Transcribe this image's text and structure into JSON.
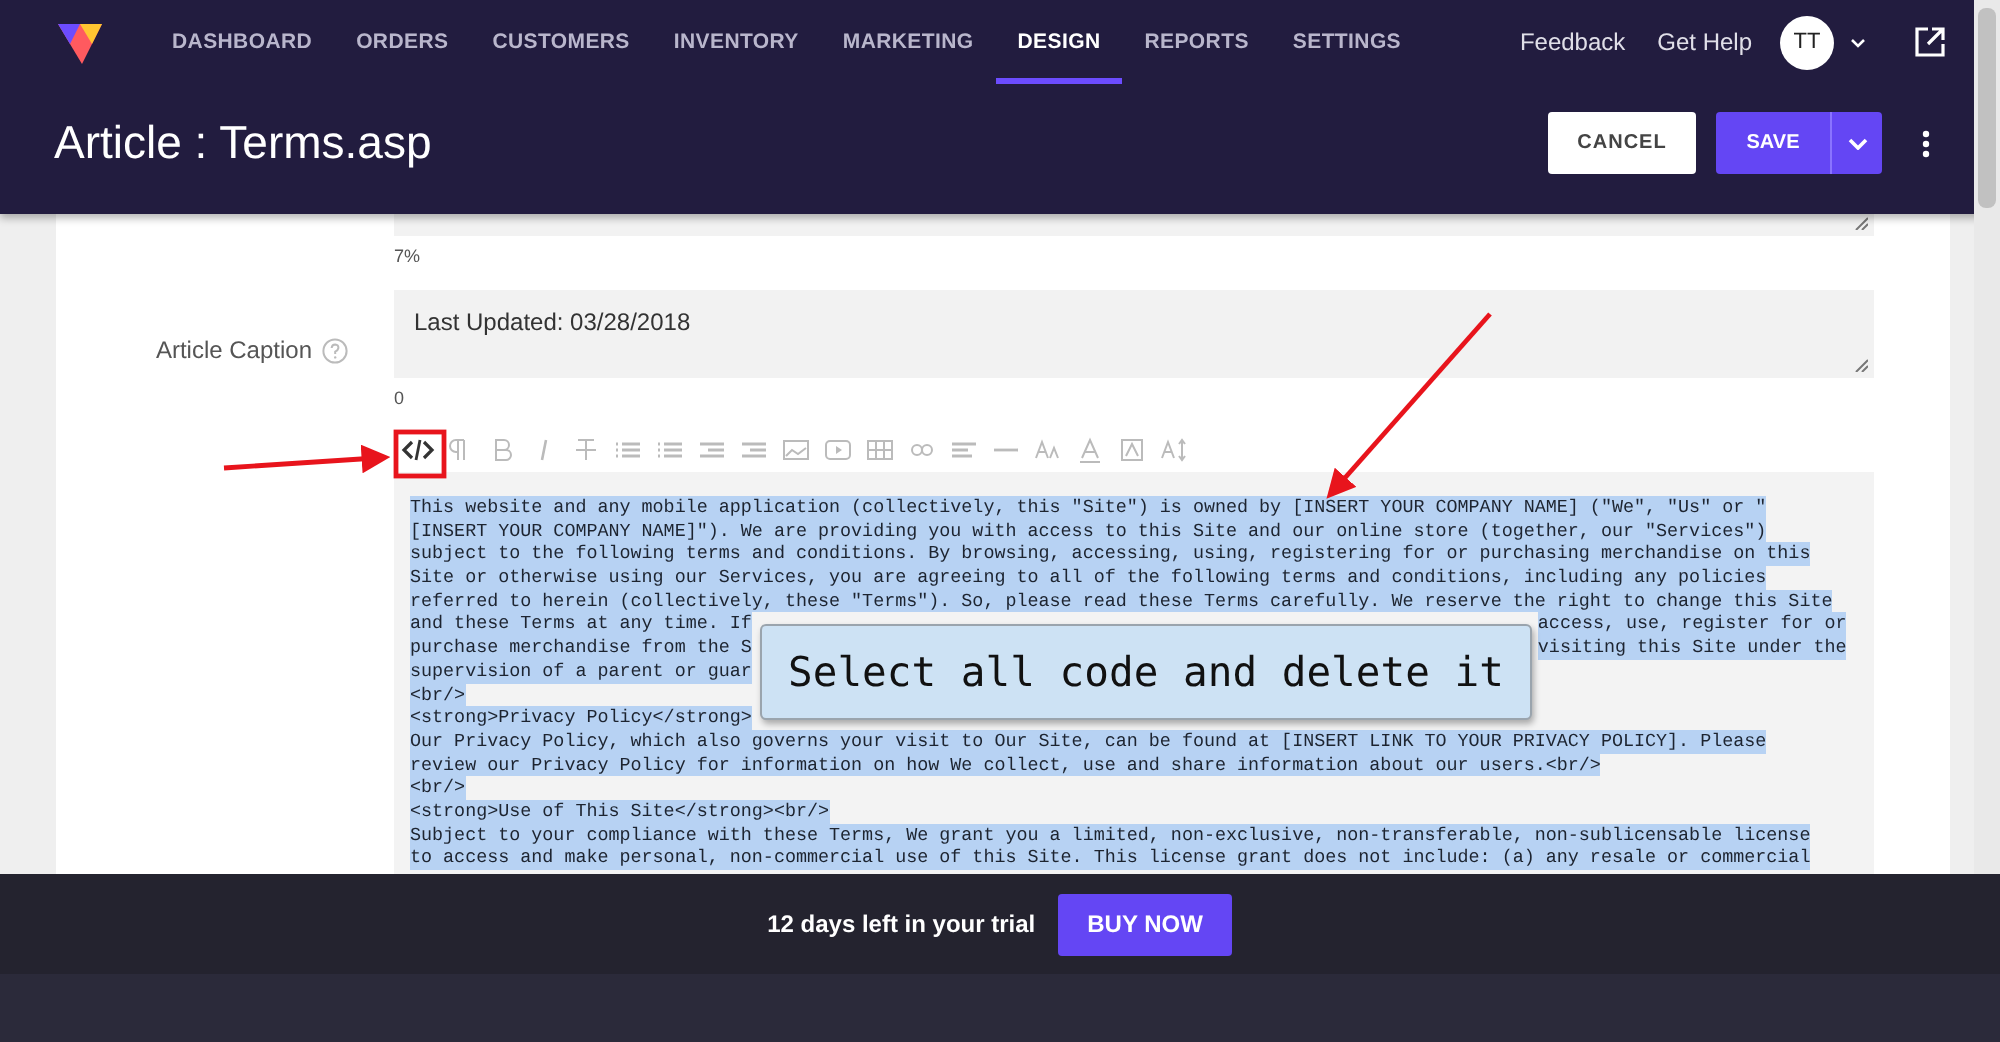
{
  "nav": {
    "items": [
      {
        "label": "DASHBOARD",
        "selected": false
      },
      {
        "label": "ORDERS",
        "selected": false
      },
      {
        "label": "CUSTOMERS",
        "selected": false
      },
      {
        "label": "INVENTORY",
        "selected": false
      },
      {
        "label": "MARKETING",
        "selected": false
      },
      {
        "label": "DESIGN",
        "selected": true
      },
      {
        "label": "REPORTS",
        "selected": false
      },
      {
        "label": "SETTINGS",
        "selected": false
      }
    ],
    "links": [
      "Feedback",
      "Get Help"
    ],
    "avatar": "TT"
  },
  "header": {
    "title": "Article : Terms.asp",
    "cancel": "CANCEL",
    "save": "SAVE"
  },
  "form": {
    "title_counter": "7%",
    "caption_label": "Article Caption",
    "caption_value": "Last Updated: 03/28/2018",
    "caption_counter": "0",
    "code_lines": [
      {
        "text": "This website and any mobile application (collectively, this \"Site\") is owned by [INSERT YOUR COMPANY NAME] (\"We\", \"Us\" or \""
      },
      {
        "text": "[INSERT YOUR COMPANY NAME]\"). We are providing you with access to this Site and our online store (together, our \"Services\")"
      },
      {
        "text": "subject to the following terms and conditions. By browsing, accessing, using, registering for or purchasing merchandise on this"
      },
      {
        "text": "Site or otherwise using our Services, you are agreeing to all of the following terms and conditions, including any policies"
      },
      {
        "text": "referred to herein (collectively, these \"Terms\"). So, please read these Terms carefully. We reserve the right to change this Site"
      },
      {
        "text": "and these Terms at any time. If",
        "after": "access, use, register for or"
      },
      {
        "text": "purchase merchandise from the S",
        "after": "visiting this Site under the"
      },
      {
        "text": "supervision of a parent or guar"
      },
      {
        "text": "<br/>"
      },
      {
        "text": "<strong>Privacy Policy</strong>"
      },
      {
        "text": "Our Privacy Policy, which also governs your visit to Our Site, can be found at [INSERT LINK TO YOUR PRIVACY POLICY]. Please"
      },
      {
        "text": "review our Privacy Policy for information on how We collect, use and share information about our users.<br/>"
      },
      {
        "text": "<br/>"
      },
      {
        "text": "<strong>Use of This Site</strong><br/>"
      },
      {
        "text": "Subject to your compliance with these Terms, We grant you a limited, non-exclusive, non-transferable, non-sublicensable license"
      },
      {
        "text": "to access and make personal, non-commercial use of this Site. This license grant does not include: (a) any resale or commercial"
      }
    ]
  },
  "callout": "Select all code and delete it",
  "trial": {
    "text": "12 days left in your trial",
    "button": "BUY NOW"
  }
}
